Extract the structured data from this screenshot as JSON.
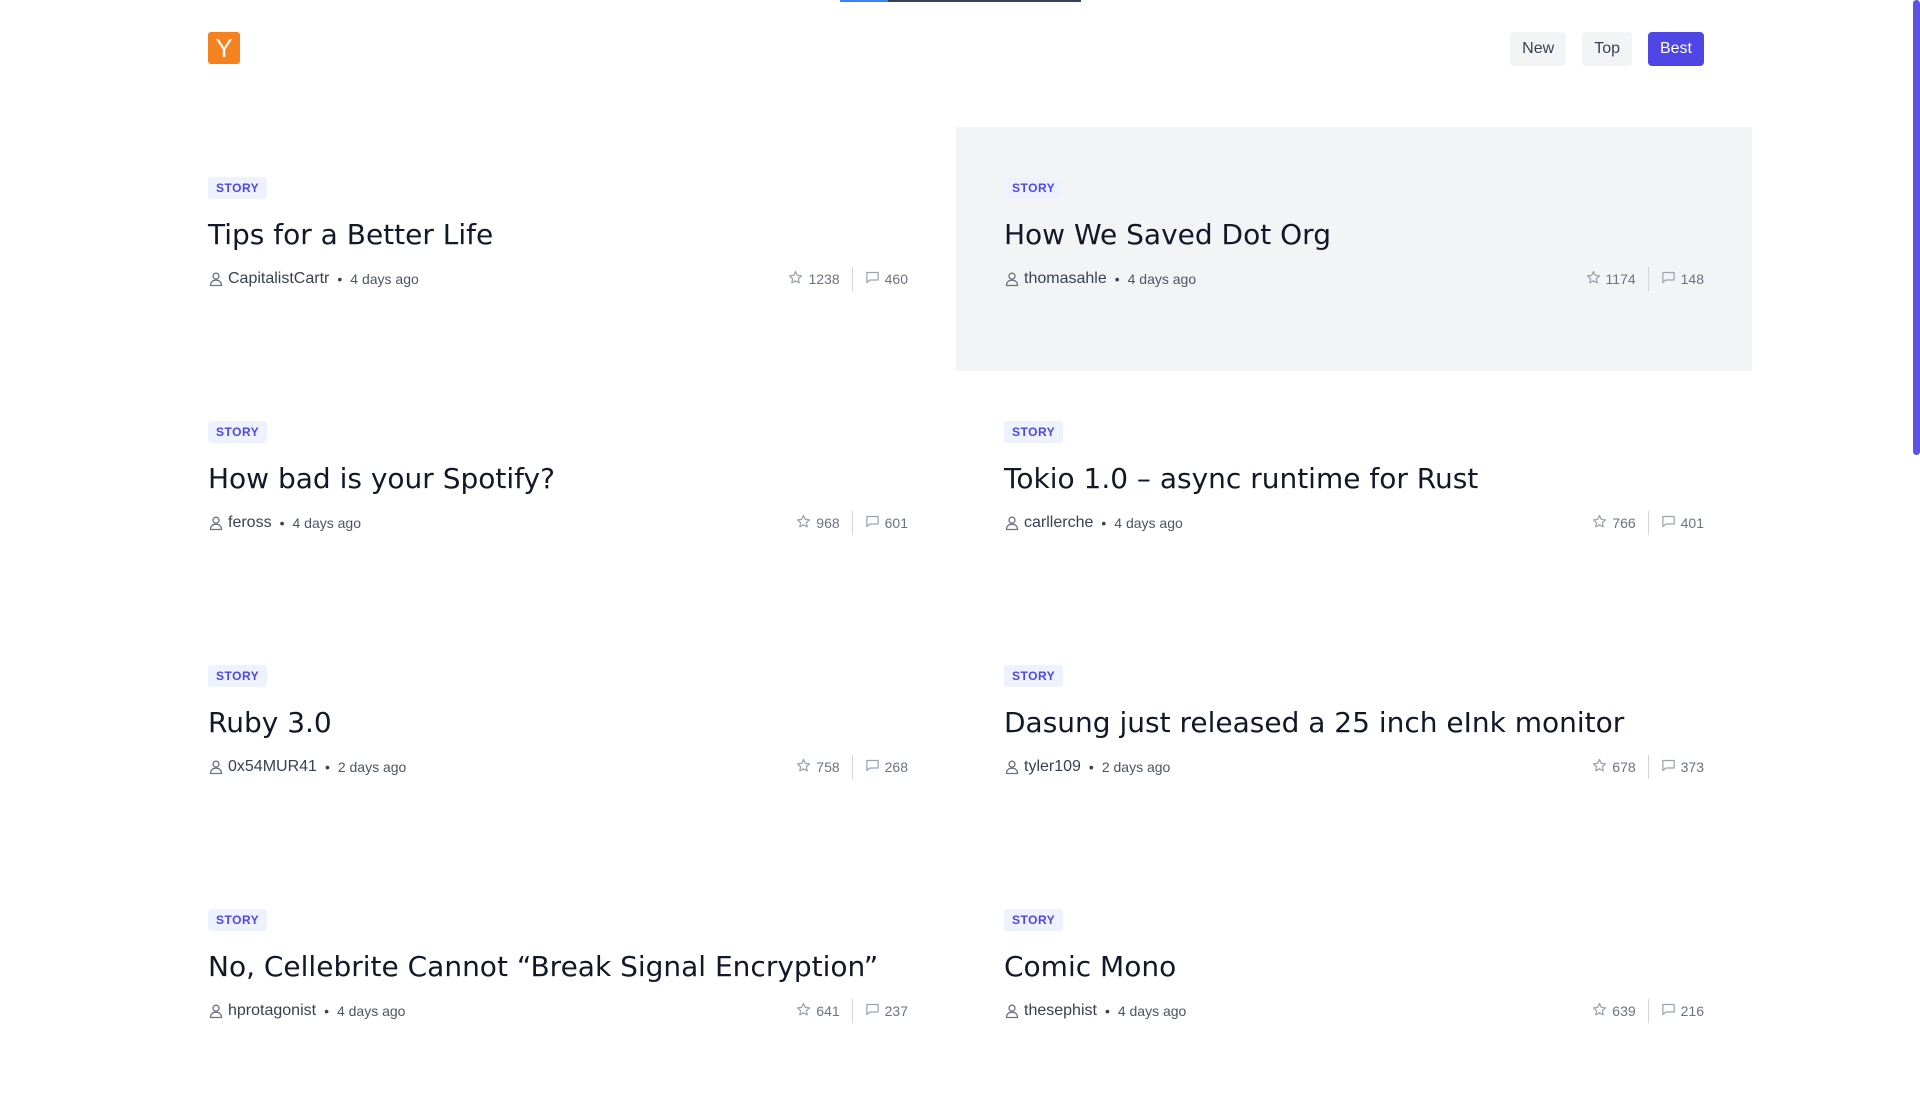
{
  "app": {
    "logo_letter": "Y",
    "brand_color": "#f6821f",
    "accent_color": "#4f46e5"
  },
  "nav": {
    "tabs": [
      {
        "label": "New",
        "active": false
      },
      {
        "label": "Top",
        "active": false
      },
      {
        "label": "Best",
        "active": true
      }
    ]
  },
  "stories": [
    {
      "tag": "STORY",
      "title": "Tips for a Better Life",
      "author": "CapitalistCartr",
      "time": "4 days ago",
      "score": "1238",
      "comments": "460"
    },
    {
      "tag": "STORY",
      "title": "How We Saved Dot Org",
      "author": "thomasahle",
      "time": "4 days ago",
      "score": "1174",
      "comments": "148"
    },
    {
      "tag": "STORY",
      "title": "How bad is your Spotify?",
      "author": "feross",
      "time": "4 days ago",
      "score": "968",
      "comments": "601"
    },
    {
      "tag": "STORY",
      "title": "Tokio 1.0 – async runtime for Rust",
      "author": "carllerche",
      "time": "4 days ago",
      "score": "766",
      "comments": "401"
    },
    {
      "tag": "STORY",
      "title": "Ruby 3.0",
      "author": "0x54MUR41",
      "time": "2 days ago",
      "score": "758",
      "comments": "268"
    },
    {
      "tag": "STORY",
      "title": "Dasung just released a 25 inch eInk monitor",
      "author": "tyler109",
      "time": "2 days ago",
      "score": "678",
      "comments": "373"
    },
    {
      "tag": "STORY",
      "title": "No, Cellebrite Cannot “Break Signal Encryption”",
      "author": "hprotagonist",
      "time": "4 days ago",
      "score": "641",
      "comments": "237"
    },
    {
      "tag": "STORY",
      "title": "Comic Mono",
      "author": "thesephist",
      "time": "4 days ago",
      "score": "639",
      "comments": "216"
    }
  ]
}
